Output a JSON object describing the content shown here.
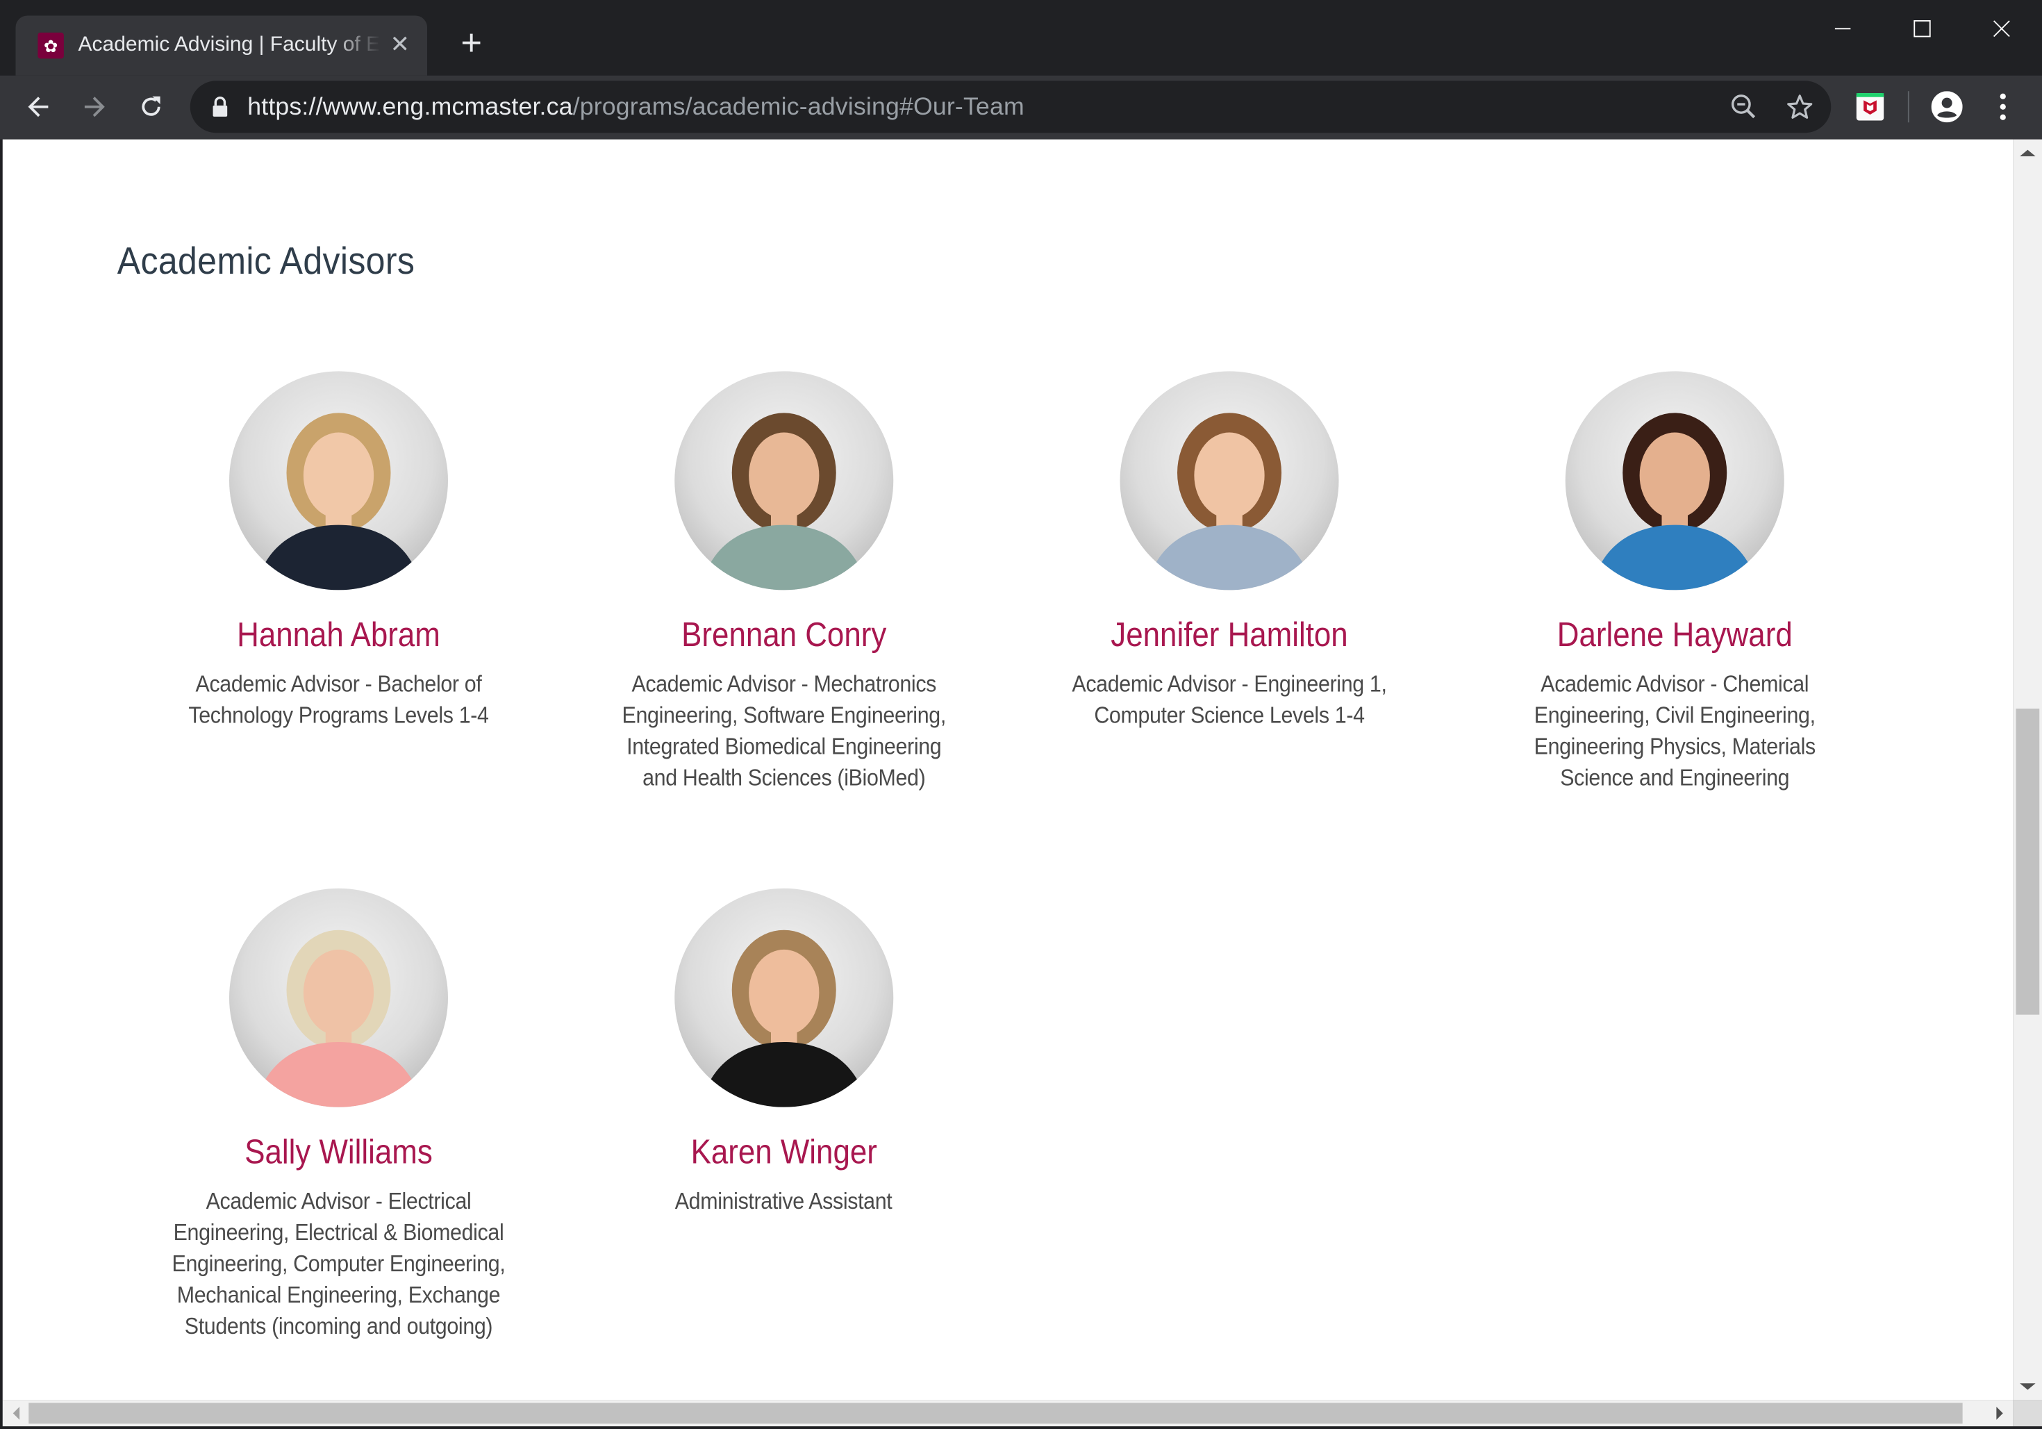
{
  "browser": {
    "tab": {
      "title": "Academic Advising | Faculty of Engineering",
      "favicon": "mcmaster-crest-icon",
      "close_icon": "close-icon"
    },
    "new_tab_icon": "plus-icon",
    "window_controls": {
      "minimize": "minimize-icon",
      "maximize": "maximize-icon",
      "close": "close-icon"
    },
    "toolbar": {
      "back_icon": "arrow-left-icon",
      "forward_icon": "arrow-right-icon",
      "reload_icon": "reload-icon",
      "lock_icon": "lock-icon",
      "url_scheme": "https://",
      "url_host": "www.eng.mcmaster.ca",
      "url_path": "/programs/academic-advising#Our-Team",
      "zoom_icon": "zoom-out-icon",
      "bookmark_icon": "star-icon",
      "extension_icon": "mcafee-icon",
      "profile_icon": "account-icon",
      "menu_icon": "more-vert-icon"
    }
  },
  "page": {
    "section_title": "Academic Advisors",
    "accent_color": "#a8174f",
    "advisors": [
      {
        "name": "Hannah Abram",
        "role": "Academic Advisor - Bachelor of Technology Programs Levels 1-4",
        "photo": "portrait-photo"
      },
      {
        "name": "Brennan Conry",
        "role": "Academic Advisor - Mechatronics Engineering, Software Engineering, Integrated Biomedical Engineering and Health Sciences (iBioMed)",
        "photo": "portrait-photo"
      },
      {
        "name": "Jennifer Hamilton",
        "role": "Academic Advisor - Engineering 1, Computer Science Levels 1-4",
        "photo": "portrait-photo"
      },
      {
        "name": "Darlene Hayward",
        "role": "Academic Advisor - Chemical Engineering, Civil Engineering, Engineering Physics, Materials Science and Engineering",
        "photo": "portrait-photo"
      },
      {
        "name": "Sally Williams",
        "role": "Academic Advisor - Electrical Engineering, Electrical & Biomedical Engineering, Computer Engineering, Mechanical Engineering, Exchange Students (incoming and outgoing)",
        "photo": "portrait-photo"
      },
      {
        "name": "Karen Winger",
        "role": "Administrative Assistant",
        "photo": "portrait-photo"
      }
    ]
  },
  "scrollbars": {
    "vertical": {
      "thumb_start": 0.45,
      "thumb_size": 0.25
    },
    "horizontal": {
      "thumb_start": 0.0,
      "thumb_size": 0.99
    }
  }
}
